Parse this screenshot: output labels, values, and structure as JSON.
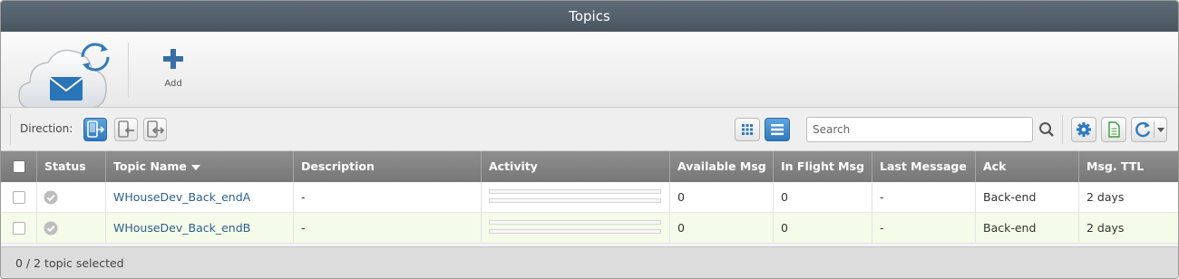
{
  "window": {
    "title": "Topics"
  },
  "toolbar": {
    "add_label": "Add"
  },
  "filter": {
    "direction_label": "Direction:",
    "search_placeholder": "Search"
  },
  "table": {
    "columns": [
      "Status",
      "Topic Name",
      "Description",
      "Activity",
      "Available Msg",
      "In Flight Msg",
      "Last Message",
      "Ack",
      "Msg. TTL"
    ],
    "rows": [
      {
        "topic_name": "WHouseDev_Back_endA",
        "description": "-",
        "available_msg": "0",
        "in_flight_msg": "0",
        "last_message": "-",
        "ack": "Back-end",
        "msg_ttl": "2 days"
      },
      {
        "topic_name": "WHouseDev_Back_endB",
        "description": "-",
        "available_msg": "0",
        "in_flight_msg": "0",
        "last_message": "-",
        "ack": "Back-end",
        "msg_ttl": "2 days"
      }
    ]
  },
  "footer": {
    "selection_text": "0 / 2 topic selected"
  },
  "colors": {
    "titlebar": "#525e68",
    "accent_blue": "#2f79bd",
    "link": "#2e5f8f",
    "alt_row": "#f4fbe8"
  },
  "icons": [
    "mail-cloud-icon",
    "plus-icon",
    "direction-both-icon",
    "direction-outgoing-icon",
    "direction-incoming-icon",
    "grid-view-icon",
    "list-view-icon",
    "search-icon",
    "gear-icon",
    "export-icon",
    "refresh-icon",
    "chevron-down-icon",
    "check-circle-icon"
  ]
}
